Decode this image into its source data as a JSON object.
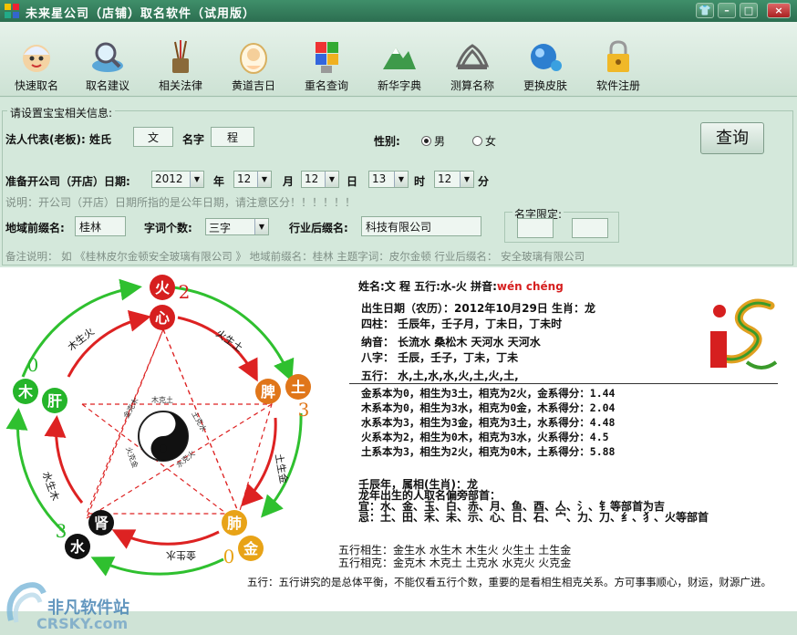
{
  "window": {
    "title": "未来星公司（店铺）取名软件（试用版）",
    "minimize": "–",
    "restore": "□",
    "close": "×",
    "shirt": "👕"
  },
  "toolbar": [
    {
      "label": "快速取名",
      "icon": "baby-face-icon"
    },
    {
      "label": "取名建议",
      "icon": "magnifier-globe-icon"
    },
    {
      "label": "相关法律",
      "icon": "brush-pot-icon"
    },
    {
      "label": "黄道吉日",
      "icon": "baby-calendar-icon"
    },
    {
      "label": "重名查询",
      "icon": "cubes-icon"
    },
    {
      "label": "新华字典",
      "icon": "mountain-icon"
    },
    {
      "label": "测算名称",
      "icon": "adidas-icon"
    },
    {
      "label": "更换皮肤",
      "icon": "water-drop-icon"
    },
    {
      "label": "软件注册",
      "icon": "lock-icon"
    }
  ],
  "form": {
    "group_title": "请设置宝宝相关信息:",
    "legal_rep_label": "法人代表(老板): 姓氏",
    "surname": "文",
    "name_label": "名字",
    "given_name": "程",
    "gender_label": "性别:",
    "male": "男",
    "female": "女",
    "query_button": "查询",
    "date_label": "准备开公司（开店）日期:",
    "year": "2012",
    "year_unit": "年",
    "month": "12",
    "month_unit": "月",
    "day": "12",
    "day_unit": "日",
    "hour": "13",
    "hour_unit": "时",
    "minute": "12",
    "minute_unit": "分",
    "date_note": "说明：开公司（开店）日期所指的是公年日期，请注意区分！！！！！！",
    "region_label": "地域前缀名:",
    "region": "桂林",
    "word_count_label": "字词个数:",
    "word_count": "三字",
    "industry_label": "行业后缀名:",
    "industry": "科技有限公司",
    "name_limit_label": "名字限定:",
    "remark": "备注说明：  如 《桂林皮尔金顿安全玻璃有限公司 》  地域前缀名：桂林        主题字词：皮尔金顿          行业后缀名：  安全玻璃有限公司"
  },
  "wuxing_diagram": {
    "organs": [
      {
        "element": "火",
        "organ": "心",
        "score": "2"
      },
      {
        "element": "土",
        "organ": "脾",
        "score": "3"
      },
      {
        "element": "金",
        "organ": "肺",
        "score": "0"
      },
      {
        "element": "水",
        "organ": "肾",
        "score": "3"
      },
      {
        "element": "木",
        "organ": "肝",
        "score": "0"
      }
    ],
    "arrows": [
      "火生土",
      "土生金",
      "金生水",
      "水生木",
      "木生火"
    ],
    "inner_labels": [
      "木克土",
      "土克水",
      "水克火",
      "火克金",
      "金克木"
    ]
  },
  "result": {
    "name_line": "姓名:文  程    五行:水-火     拼音:",
    "pinyin": "wén chéng",
    "birth_line": "出生日期（农历）：2012年10月29日       生肖：龙",
    "sizhu_line": "四柱：  壬辰年，壬子月，丁未日，丁未时",
    "nayin_line": "纳音：  长流水   桑松木   天河水   天河水",
    "bazi_line": "八字：  壬辰，壬子，丁未，丁未",
    "wuxing_line": "五行：  水,土,水,水,火,土,火,土,",
    "score_lines": [
      "金系本为0，相生为3土，相克为2火，金系得分：1.44",
      "木系本为0，相生为3水，相克为0金，木系得分：2.04",
      "水系本为3，相生为3金，相克为3土，水系得分：4.48",
      "火系本为2，相生为0木，相克为3水，火系得分：4.5",
      "土系本为3，相生为2火，相克为0木，土系得分：5.88"
    ],
    "zodiac_title": "壬辰年，属相(生肖)：龙",
    "zodiac_sub": "龙年出生的人取名偏旁部首：",
    "good": "宜：水、金、玉、白、赤、月、鱼、酉、亼、氵、钅等部首为吉",
    "bad": "忌：土、田、禾、未、示、心、日、石、宀、力、刀、纟、犭、火等部首",
    "xiangsheng_label": "五行相生：",
    "xiangsheng": "金生水   水生木   木生火   火生土   土生金",
    "xiangke_label": "五行相克：",
    "xiangke": "金克木   木克土   土克水   水克火   火克金",
    "summary": "五行：五行讲究的是总体平衡，不能仅看五行个数，重要的是看相生相克关系。方可事事顺心，财运，财源广进。"
  },
  "watermark": {
    "line1": "非凡软件站",
    "line2": "CRSKY.com"
  },
  "colors": {
    "title_bar": "#2c6e50",
    "panel": "#d4e8db",
    "fire": "#d61f1f",
    "earth": "#e0761a",
    "metal": "#e8a317",
    "water": "#111111",
    "wood": "#25b52a"
  }
}
